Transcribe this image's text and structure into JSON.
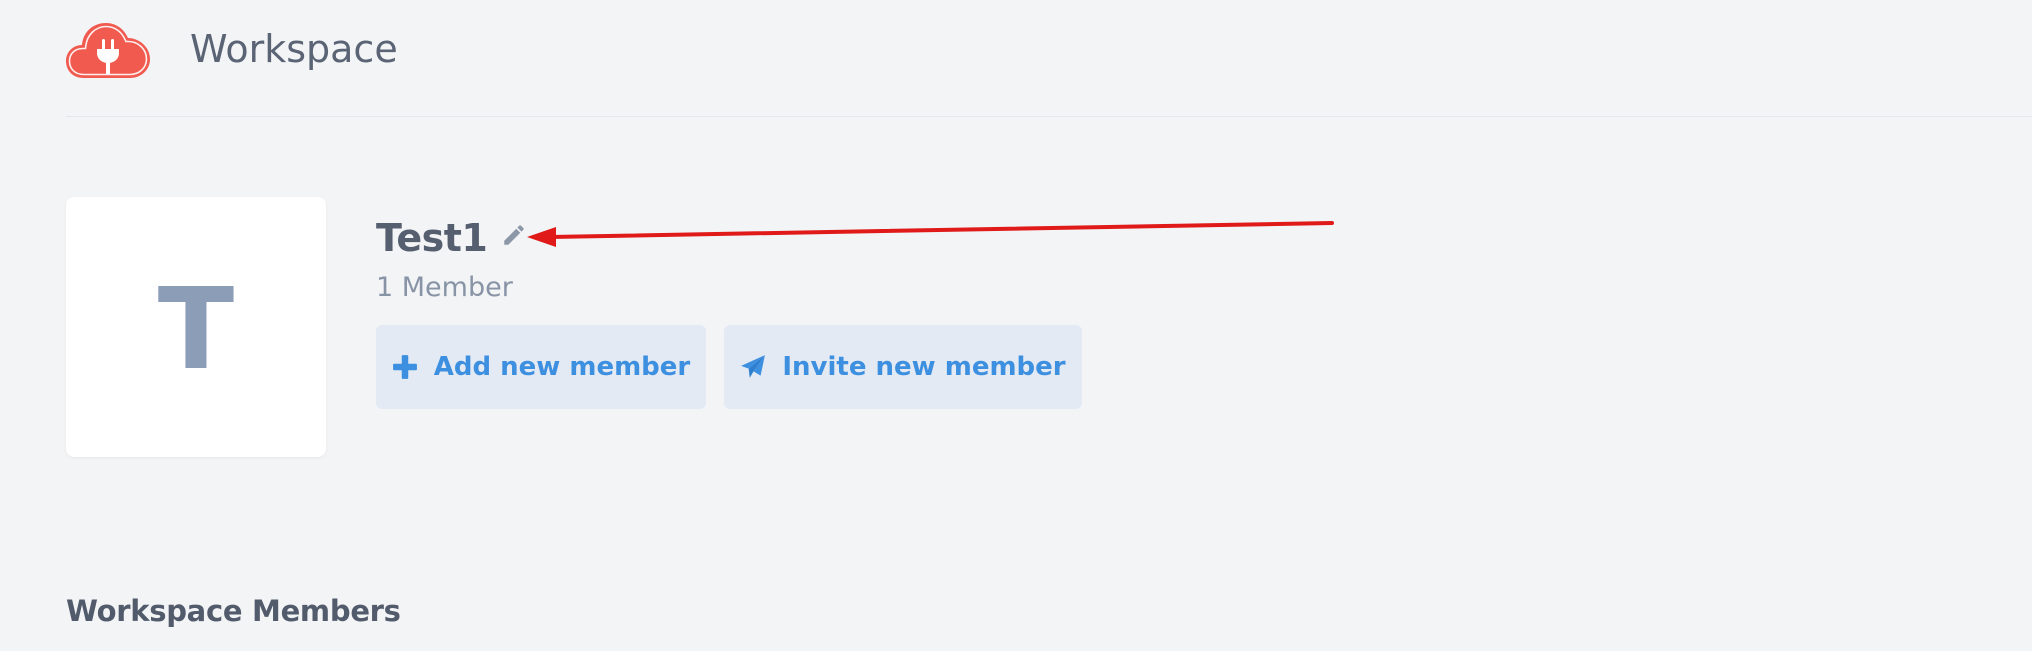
{
  "app": {
    "title": "Workspace",
    "logo_icon": "cloud-plug-icon",
    "brand_color": "#f05a4f"
  },
  "workspace": {
    "avatar_letter": "T",
    "name": "Test1",
    "edit_icon": "pencil-icon",
    "member_count": "1 Member"
  },
  "actions": {
    "add_member_label": "Add new member",
    "add_member_icon": "plus-icon",
    "invite_member_label": "Invite new member",
    "invite_member_icon": "paper-plane-icon",
    "accent_color": "#3d8fe0"
  },
  "members_section": {
    "heading": "Workspace Members"
  },
  "annotation": {
    "type": "arrow",
    "color": "#e01919"
  }
}
